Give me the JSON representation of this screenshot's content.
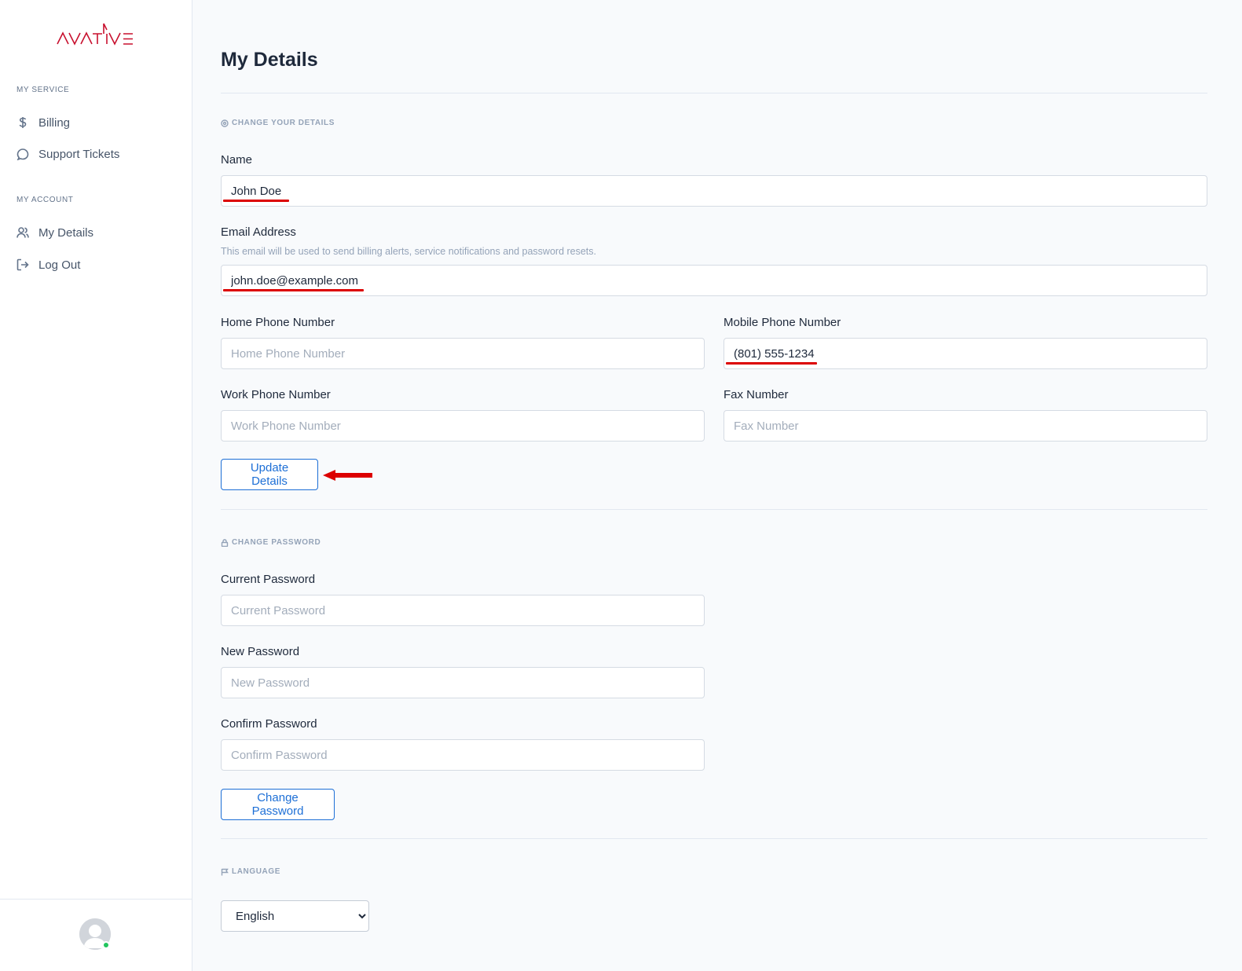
{
  "brand": {
    "logo_text": "AVATIVE",
    "color": "#c8102e"
  },
  "sidebar": {
    "sections": [
      {
        "heading": "MY SERVICE",
        "items": [
          {
            "label": "Billing",
            "icon": "dollar-icon"
          },
          {
            "label": "Support Tickets",
            "icon": "chat-bubble-icon"
          }
        ]
      },
      {
        "heading": "MY ACCOUNT",
        "items": [
          {
            "label": "My Details",
            "icon": "users-icon"
          },
          {
            "label": "Log Out",
            "icon": "logout-icon"
          }
        ]
      }
    ],
    "status_color": "#22c55e"
  },
  "main": {
    "title": "My Details",
    "details": {
      "section_label": "CHANGE YOUR DETAILS",
      "name": {
        "label": "Name",
        "value": "John Doe"
      },
      "email": {
        "label": "Email Address",
        "help": "This email will be used to send billing alerts, service notifications and password resets.",
        "value": "john.doe@example.com"
      },
      "home_phone": {
        "label": "Home Phone Number",
        "placeholder": "Home Phone Number",
        "value": ""
      },
      "mobile_phone": {
        "label": "Mobile Phone Number",
        "placeholder": "Mobile Phone Number",
        "value": "(801) 555-1234"
      },
      "work_phone": {
        "label": "Work Phone Number",
        "placeholder": "Work Phone Number",
        "value": ""
      },
      "fax": {
        "label": "Fax Number",
        "placeholder": "Fax Number",
        "value": ""
      },
      "submit_label": "Update Details"
    },
    "password": {
      "section_label": "CHANGE PASSWORD",
      "current": {
        "label": "Current Password",
        "placeholder": "Current Password"
      },
      "new": {
        "label": "New Password",
        "placeholder": "New Password"
      },
      "confirm": {
        "label": "Confirm Password",
        "placeholder": "Confirm Password"
      },
      "submit_label": "Change Password"
    },
    "language": {
      "section_label": "LANGUAGE",
      "selected": "English"
    }
  },
  "colors": {
    "accent": "#1d6fd6",
    "annotation": "#dc0000"
  }
}
